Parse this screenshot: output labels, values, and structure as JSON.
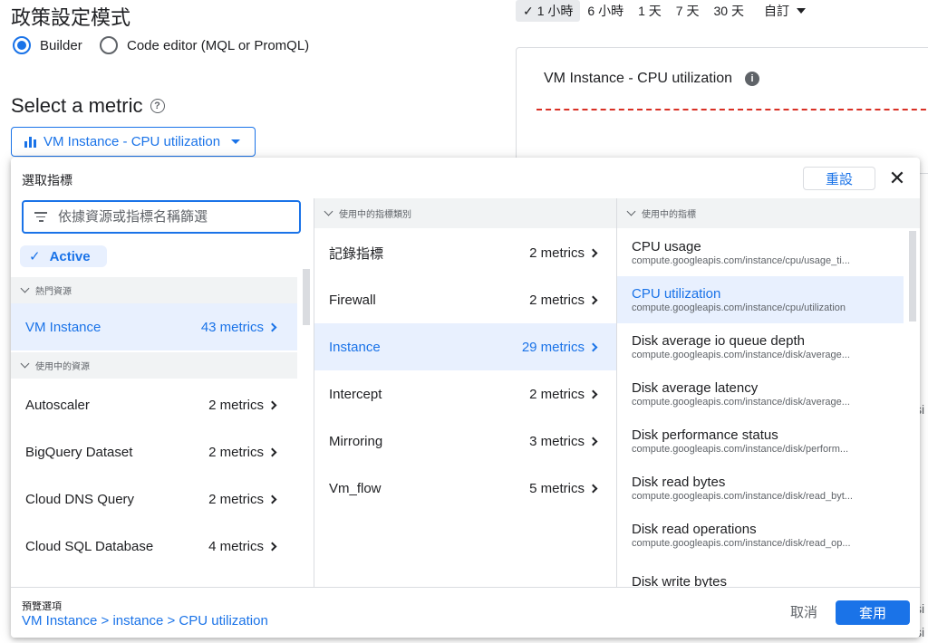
{
  "page": {
    "title": "政策設定模式",
    "mode_options": [
      {
        "label": "Builder",
        "selected": true
      },
      {
        "label": "Code editor (MQL or PromQL)",
        "selected": false
      }
    ],
    "select_metric_title": "Select a metric",
    "metric_dropdown_label": "VM Instance - CPU utilization"
  },
  "time_range": {
    "items": [
      "1 小時",
      "6 小時",
      "1 天",
      "7 天",
      "30 天",
      "自訂"
    ],
    "selected_check": "✓"
  },
  "chart": {
    "title": "VM Instance - CPU utilization",
    "info_icon": "i",
    "threshold_color": "#d93025"
  },
  "background_fragments": [
    "si",
    "si",
    "si"
  ],
  "dialog": {
    "title": "選取指標",
    "reset_label": "重設",
    "close_icon": "✕",
    "filter_placeholder": "依據資源或指標名稱篩選",
    "active_chip": "Active",
    "col1_sections": {
      "popular": "熱門資源",
      "in_use": "使用中的資源"
    },
    "popular_resources": [
      {
        "label": "VM Instance",
        "count": "43 metrics",
        "selected": true
      }
    ],
    "in_use_resources": [
      {
        "label": "Autoscaler",
        "count": "2 metrics"
      },
      {
        "label": "BigQuery Dataset",
        "count": "2 metrics"
      },
      {
        "label": "Cloud DNS Query",
        "count": "2 metrics"
      },
      {
        "label": "Cloud SQL Database",
        "count": "4 metrics"
      }
    ],
    "col2_header": "使用中的指標類別",
    "categories": [
      {
        "label": "記錄指標",
        "count": "2 metrics"
      },
      {
        "label": "Firewall",
        "count": "2 metrics"
      },
      {
        "label": "Instance",
        "count": "29 metrics",
        "selected": true
      },
      {
        "label": "Intercept",
        "count": "2 metrics"
      },
      {
        "label": "Mirroring",
        "count": "3 metrics"
      },
      {
        "label": "Vm_flow",
        "count": "5 metrics"
      }
    ],
    "col3_header": "使用中的指標",
    "metrics": [
      {
        "title": "CPU usage",
        "path": "compute.googleapis.com/instance/cpu/usage_ti..."
      },
      {
        "title": "CPU utilization",
        "path": "compute.googleapis.com/instance/cpu/utilization",
        "selected": true
      },
      {
        "title": "Disk average io queue depth",
        "path": "compute.googleapis.com/instance/disk/average..."
      },
      {
        "title": "Disk average latency",
        "path": "compute.googleapis.com/instance/disk/average..."
      },
      {
        "title": "Disk performance status",
        "path": "compute.googleapis.com/instance/disk/perform..."
      },
      {
        "title": "Disk read bytes",
        "path": "compute.googleapis.com/instance/disk/read_byt..."
      },
      {
        "title": "Disk read operations",
        "path": "compute.googleapis.com/instance/disk/read_op..."
      },
      {
        "title": "Disk write bytes",
        "path": ""
      }
    ],
    "footer": {
      "preview_label": "預覽選項",
      "preview_path": "VM Instance > instance > CPU utilization",
      "cancel_label": "取消",
      "apply_label": "套用"
    }
  }
}
